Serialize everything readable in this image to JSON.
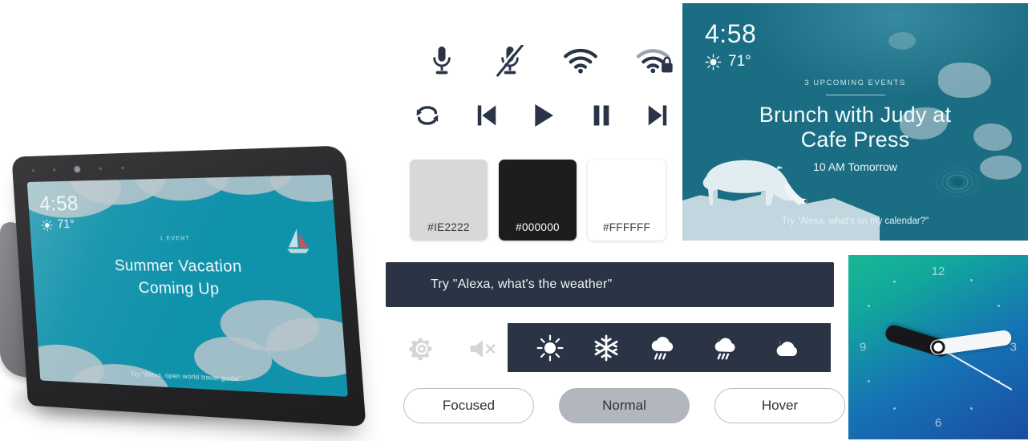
{
  "device": {
    "name": "echo-show",
    "screen": {
      "time": "4:58",
      "temperature": "71°",
      "weather_icon": "sun-icon",
      "event_count_label": "1 EVENT",
      "event_title_line1": "Summer Vacation",
      "event_title_line2": "Coming Up",
      "hint": "Try \"Alexa, open world travel guide\"",
      "background_color": "#1192AB",
      "cloud_color": "#B9C6CB"
    },
    "body_color": "#2B2B2D",
    "fabric_color": "#6E6E73"
  },
  "status_icons": [
    {
      "name": "microphone-icon",
      "label": "Microphone"
    },
    {
      "name": "microphone-muted-icon",
      "label": "Microphone muted"
    },
    {
      "name": "wifi-icon",
      "label": "Wi-Fi"
    },
    {
      "name": "wifi-locked-icon",
      "label": "Wi-Fi secured"
    }
  ],
  "media_controls": [
    {
      "name": "repeat-icon",
      "label": "Repeat"
    },
    {
      "name": "previous-icon",
      "label": "Previous"
    },
    {
      "name": "play-icon",
      "label": "Play"
    },
    {
      "name": "pause-icon",
      "label": "Pause"
    },
    {
      "name": "next-icon",
      "label": "Next"
    }
  ],
  "swatches": [
    {
      "name": "swatch-light",
      "label": "#IE2222",
      "fill": "#D6D8DA",
      "text_color": "#3A3A3C"
    },
    {
      "name": "swatch-black",
      "label": "#000000",
      "fill": "#1D1D20",
      "text_color": "#FFFFFF"
    },
    {
      "name": "swatch-white",
      "label": "#FFFFFF",
      "fill": "#FFFFFF",
      "text_color": "#3A3A3C"
    }
  ],
  "banner": {
    "text": "Try \"Alexa, what's the weather\"",
    "background": "#2B3444",
    "text_color": "#F0F3F7"
  },
  "controls": {
    "gear_icon": "gear-icon",
    "mute_icon": "speaker-muted-icon",
    "icon_color": "#D5D5D5"
  },
  "weather_bar": {
    "background": "#2B3444",
    "icons": [
      {
        "name": "sun-icon",
        "label": "Sunny"
      },
      {
        "name": "snowflake-icon",
        "label": "Snow"
      },
      {
        "name": "rain-cloud-icon",
        "label": "Rain"
      },
      {
        "name": "night-rain-icon",
        "label": "Night rain"
      },
      {
        "name": "night-cloud-icon",
        "label": "Night cloudy"
      }
    ]
  },
  "pills": [
    {
      "name": "focused",
      "label": "Focused",
      "state": "outline"
    },
    {
      "name": "normal",
      "label": "Normal",
      "state": "filled"
    },
    {
      "name": "hover",
      "label": "Hover",
      "state": "outline"
    }
  ],
  "calendar": {
    "time": "4:58",
    "temperature": "71°",
    "weather_icon": "sun-icon",
    "events_label": "3 UPCOMING EVENTS",
    "title_line1": "Brunch with Judy at",
    "title_line2": "Cafe Press",
    "when": "10 AM Tomorrow",
    "hint": "Try \"Alexa, what's on my calendar?\"",
    "background": "#1A6D82",
    "ice_color": "#CFE0E6",
    "bear_color": "#DCE9ED"
  },
  "clock": {
    "numerals": {
      "n12": "12",
      "n3": "3",
      "n6": "6",
      "n9": "9"
    },
    "gradient_start": "#18B894",
    "gradient_end": "#1A4CA4",
    "hour_hand_color": "#17171A",
    "minute_hand_color": "#F4F6F8"
  }
}
